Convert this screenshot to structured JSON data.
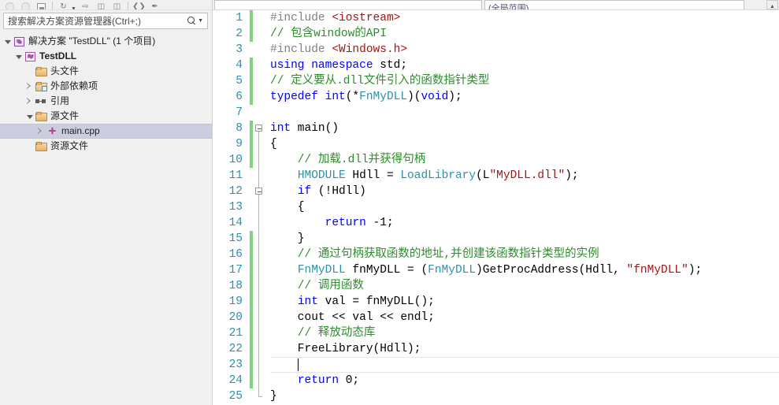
{
  "solution_explorer": {
    "toolbar": {
      "buttons": [
        {
          "name": "back-button",
          "glyph": "circle"
        },
        {
          "name": "forward-button",
          "glyph": "circle"
        },
        {
          "name": "home-button",
          "glyph": "square"
        },
        {
          "name": "pending-changes-button",
          "glyph": "↻"
        },
        {
          "name": "sync-with-active-document-button",
          "glyph": "⇨"
        },
        {
          "name": "properties-button",
          "glyph": "▤"
        },
        {
          "name": "show-all-files-button",
          "glyph": "▥"
        },
        {
          "name": "collapse-all-button",
          "glyph": "‹›"
        },
        {
          "name": "preview-selected-items-button",
          "glyph": "✎"
        }
      ]
    },
    "search": {
      "placeholder": "搜索解决方案资源管理器(Ctrl+;)",
      "value": ""
    },
    "tree": [
      {
        "label": "解决方案 \"TestDLL\" (1 个项目)",
        "icon": "solution-icon",
        "indent": 0,
        "twisty": "down",
        "bold": false,
        "selected": false
      },
      {
        "label": "TestDLL",
        "icon": "project-icon",
        "indent": 1,
        "twisty": "down",
        "bold": true,
        "selected": false
      },
      {
        "label": "头文件",
        "icon": "folder-icon",
        "indent": 2,
        "twisty": "none",
        "bold": false,
        "selected": false
      },
      {
        "label": "外部依赖项",
        "icon": "folder-dependencies-icon",
        "indent": 2,
        "twisty": "right",
        "bold": false,
        "selected": false
      },
      {
        "label": "引用",
        "icon": "references-icon",
        "indent": 2,
        "twisty": "right",
        "bold": false,
        "selected": false
      },
      {
        "label": "源文件",
        "icon": "folder-icon",
        "indent": 2,
        "twisty": "down",
        "bold": false,
        "selected": false
      },
      {
        "label": "main.cpp",
        "icon": "cpp-file-icon",
        "indent": 3,
        "twisty": "right",
        "bold": false,
        "selected": true
      },
      {
        "label": "资源文件",
        "icon": "folder-icon",
        "indent": 2,
        "twisty": "none",
        "bold": false,
        "selected": false
      }
    ]
  },
  "editor": {
    "navbar": {
      "scope_combo": "",
      "member_combo": "(全局范围)"
    },
    "cursor": {
      "line": 23,
      "column": 5
    },
    "lines": [
      {
        "number": 1,
        "changed": true,
        "tokens": [
          {
            "t": "pre",
            "s": "#include "
          },
          {
            "t": "str",
            "s": "<iostream>"
          }
        ]
      },
      {
        "number": 2,
        "changed": true,
        "tokens": [
          {
            "t": "com",
            "s": "// 包含window的API"
          }
        ]
      },
      {
        "number": 3,
        "changed": false,
        "tokens": [
          {
            "t": "pre",
            "s": "#include "
          },
          {
            "t": "str",
            "s": "<Windows.h>"
          }
        ]
      },
      {
        "number": 4,
        "changed": true,
        "tokens": [
          {
            "t": "kw",
            "s": "using"
          },
          {
            "t": "plain",
            "s": " "
          },
          {
            "t": "kw",
            "s": "namespace"
          },
          {
            "t": "plain",
            "s": " std;"
          }
        ]
      },
      {
        "number": 5,
        "changed": true,
        "tokens": [
          {
            "t": "com",
            "s": "// 定义要从.dll文件引入的函数指针类型"
          }
        ]
      },
      {
        "number": 6,
        "changed": true,
        "tokens": [
          {
            "t": "kw",
            "s": "typedef"
          },
          {
            "t": "plain",
            "s": " "
          },
          {
            "t": "kw",
            "s": "int"
          },
          {
            "t": "plain",
            "s": "(*"
          },
          {
            "t": "type",
            "s": "FnMyDLL"
          },
          {
            "t": "plain",
            "s": ")("
          },
          {
            "t": "kw",
            "s": "void"
          },
          {
            "t": "plain",
            "s": ");"
          }
        ]
      },
      {
        "number": 7,
        "changed": false,
        "tokens": []
      },
      {
        "number": 8,
        "changed": true,
        "tokens": [
          {
            "t": "kw",
            "s": "int"
          },
          {
            "t": "plain",
            "s": " main()"
          }
        ]
      },
      {
        "number": 9,
        "changed": true,
        "tokens": [
          {
            "t": "plain",
            "s": "{"
          }
        ]
      },
      {
        "number": 10,
        "changed": true,
        "tokens": [
          {
            "t": "com",
            "s": "    // 加载.dll并获得句柄"
          }
        ]
      },
      {
        "number": 11,
        "changed": false,
        "tokens": [
          {
            "t": "plain",
            "s": "    "
          },
          {
            "t": "type",
            "s": "HMODULE"
          },
          {
            "t": "plain",
            "s": " Hdll = "
          },
          {
            "t": "type",
            "s": "LoadLibrary"
          },
          {
            "t": "plain",
            "s": "(L"
          },
          {
            "t": "str",
            "s": "\"MyDLL.dll\""
          },
          {
            "t": "plain",
            "s": ");"
          }
        ]
      },
      {
        "number": 12,
        "changed": false,
        "tokens": [
          {
            "t": "plain",
            "s": "    "
          },
          {
            "t": "kw",
            "s": "if"
          },
          {
            "t": "plain",
            "s": " (!Hdll)"
          }
        ]
      },
      {
        "number": 13,
        "changed": false,
        "tokens": [
          {
            "t": "plain",
            "s": "    {"
          }
        ]
      },
      {
        "number": 14,
        "changed": false,
        "tokens": [
          {
            "t": "plain",
            "s": "        "
          },
          {
            "t": "kw",
            "s": "return"
          },
          {
            "t": "plain",
            "s": " -1;"
          }
        ]
      },
      {
        "number": 15,
        "changed": true,
        "tokens": [
          {
            "t": "plain",
            "s": "    }"
          }
        ]
      },
      {
        "number": 16,
        "changed": true,
        "tokens": [
          {
            "t": "com",
            "s": "    // 通过句柄获取函数的地址,并创建该函数指针类型的实例"
          }
        ]
      },
      {
        "number": 17,
        "changed": true,
        "tokens": [
          {
            "t": "plain",
            "s": "    "
          },
          {
            "t": "type",
            "s": "FnMyDLL"
          },
          {
            "t": "plain",
            "s": " fnMyDLL = ("
          },
          {
            "t": "type",
            "s": "FnMyDLL"
          },
          {
            "t": "plain",
            "s": ")GetProcAddress(Hdll, "
          },
          {
            "t": "str",
            "s": "\"fnMyDLL\""
          },
          {
            "t": "plain",
            "s": ");"
          }
        ]
      },
      {
        "number": 18,
        "changed": true,
        "tokens": [
          {
            "t": "com",
            "s": "    // 调用函数"
          }
        ]
      },
      {
        "number": 19,
        "changed": true,
        "tokens": [
          {
            "t": "plain",
            "s": "    "
          },
          {
            "t": "kw",
            "s": "int"
          },
          {
            "t": "plain",
            "s": " val = fnMyDLL();"
          }
        ]
      },
      {
        "number": 20,
        "changed": true,
        "tokens": [
          {
            "t": "plain",
            "s": "    cout "
          },
          {
            "t": "op",
            "s": "<<"
          },
          {
            "t": "plain",
            "s": " val "
          },
          {
            "t": "op",
            "s": "<<"
          },
          {
            "t": "plain",
            "s": " endl;"
          }
        ]
      },
      {
        "number": 21,
        "changed": true,
        "tokens": [
          {
            "t": "com",
            "s": "    // 释放动态库"
          }
        ]
      },
      {
        "number": 22,
        "changed": true,
        "tokens": [
          {
            "t": "plain",
            "s": "    FreeLibrary(Hdll);"
          }
        ]
      },
      {
        "number": 23,
        "changed": true,
        "current": true,
        "tokens": []
      },
      {
        "number": 24,
        "changed": true,
        "tokens": [
          {
            "t": "plain",
            "s": "    "
          },
          {
            "t": "kw",
            "s": "return"
          },
          {
            "t": "plain",
            "s": " 0;"
          }
        ]
      },
      {
        "number": 25,
        "changed": false,
        "tokens": [
          {
            "t": "plain",
            "s": "}"
          }
        ]
      }
    ],
    "folds": [
      {
        "line": 8,
        "type": "box"
      },
      {
        "line": 12,
        "type": "box"
      }
    ]
  },
  "colors": {
    "selection": "#cdcde0",
    "change_bar": "#7ed37e",
    "line_number": "#2b91af",
    "comment": "#2e8b2e",
    "keyword": "#0000ff",
    "string": "#a31515",
    "type": "#2b91af",
    "preprocessor": "#808080",
    "panel_bg": "#f0f0f0",
    "editor_bg": "#ffffff"
  }
}
